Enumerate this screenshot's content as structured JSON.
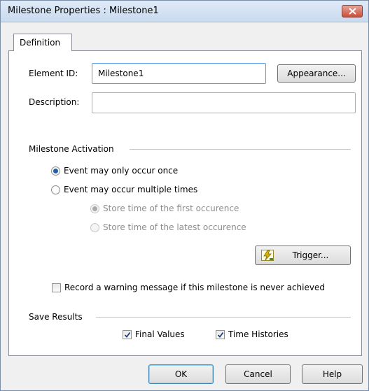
{
  "window": {
    "title": "Milestone Properties : Milestone1"
  },
  "tabs": [
    {
      "label": "Definition"
    }
  ],
  "element_id": {
    "label": "Element ID:",
    "value": "Milestone1"
  },
  "appearance_button": {
    "label": "Appearance..."
  },
  "description": {
    "label": "Description:",
    "value": ""
  },
  "activation": {
    "heading": "Milestone Activation",
    "once_label": "Event may only occur once",
    "once_selected": true,
    "multiple_label": "Event may occur multiple times",
    "multiple_selected": false,
    "first_label": "Store time of the first occurence",
    "first_selected": true,
    "latest_label": "Store time of the latest occurence",
    "latest_selected": false,
    "sub_options_enabled": false
  },
  "trigger_button": {
    "label": "Trigger...",
    "icon": "lightning-icon"
  },
  "warning": {
    "label": "Record a warning message if this milestone is never achieved",
    "checked": false
  },
  "save_results": {
    "heading": "Save Results",
    "final_values_label": "Final Values",
    "final_values_checked": true,
    "time_histories_label": "Time Histories",
    "time_histories_checked": true
  },
  "footer": {
    "ok_label": "OK",
    "cancel_label": "Cancel",
    "help_label": "Help"
  },
  "colors": {
    "accent": "#569de5",
    "radio_dot": "#1f5fa8",
    "trigger_icon": "#d9b400"
  }
}
